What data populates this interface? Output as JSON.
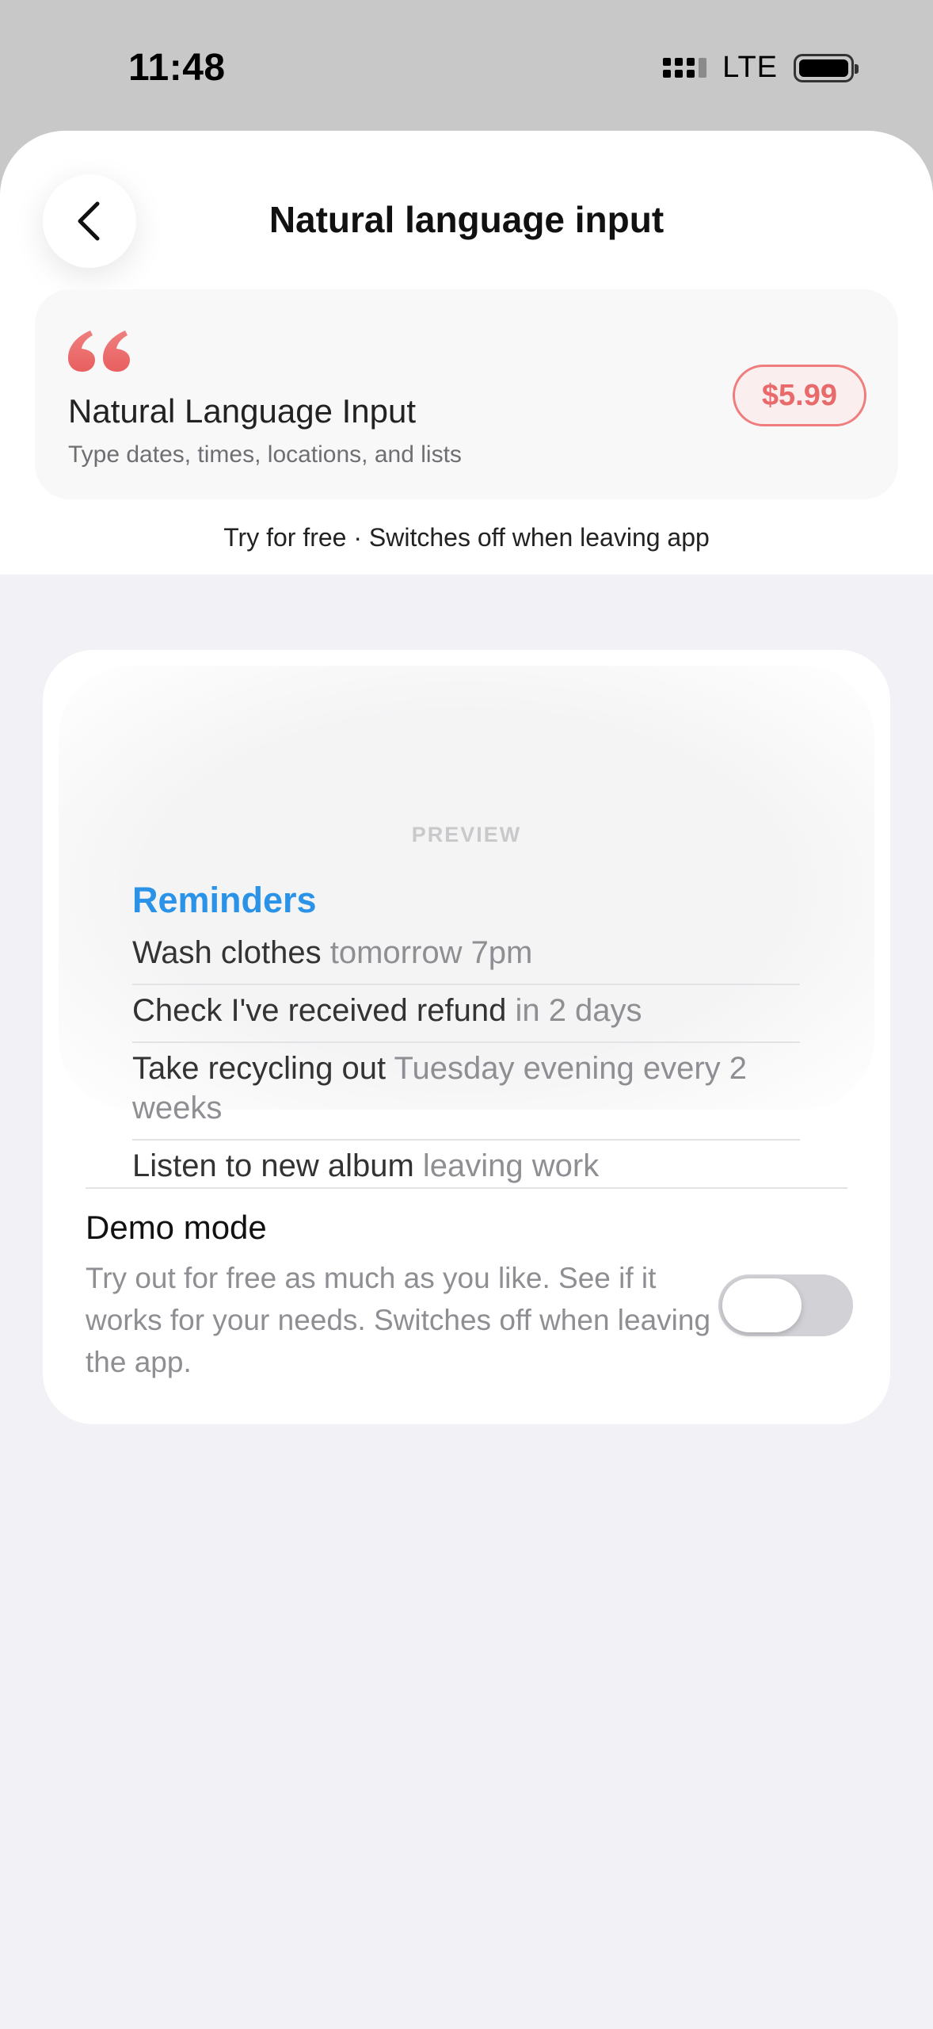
{
  "status_bar": {
    "time": "11:48",
    "network": "LTE",
    "icons": [
      "signal-icon",
      "battery-icon"
    ]
  },
  "header": {
    "title": "Natural language input",
    "back_icon": "chevron-left-icon"
  },
  "feature": {
    "icon": "quote-icon",
    "title": "Natural Language Input",
    "subtitle": "Type dates, times, locations, and lists",
    "price": "$5.99",
    "trial_note": "Try for free · Switches off when leaving app"
  },
  "preview": {
    "label": "PREVIEW",
    "heading": "Reminders",
    "items": [
      {
        "task": "Wash clothes",
        "when": "tomorrow 7pm"
      },
      {
        "task": "Check I've received refund",
        "when": "in 2 days"
      },
      {
        "task": "Take recycling out",
        "when": "Tuesday evening every 2 weeks"
      },
      {
        "task": "Listen to new album",
        "when": "leaving work"
      }
    ]
  },
  "demo_mode": {
    "title": "Demo mode",
    "description": "Try out for free as much as you like. See if it works for your needs. Switches off when leaving the app.",
    "enabled": false
  },
  "colors": {
    "accent_blue": "#2a93e8",
    "price_red": "#e86a6a",
    "sheet_background": "#f1f1f6"
  }
}
